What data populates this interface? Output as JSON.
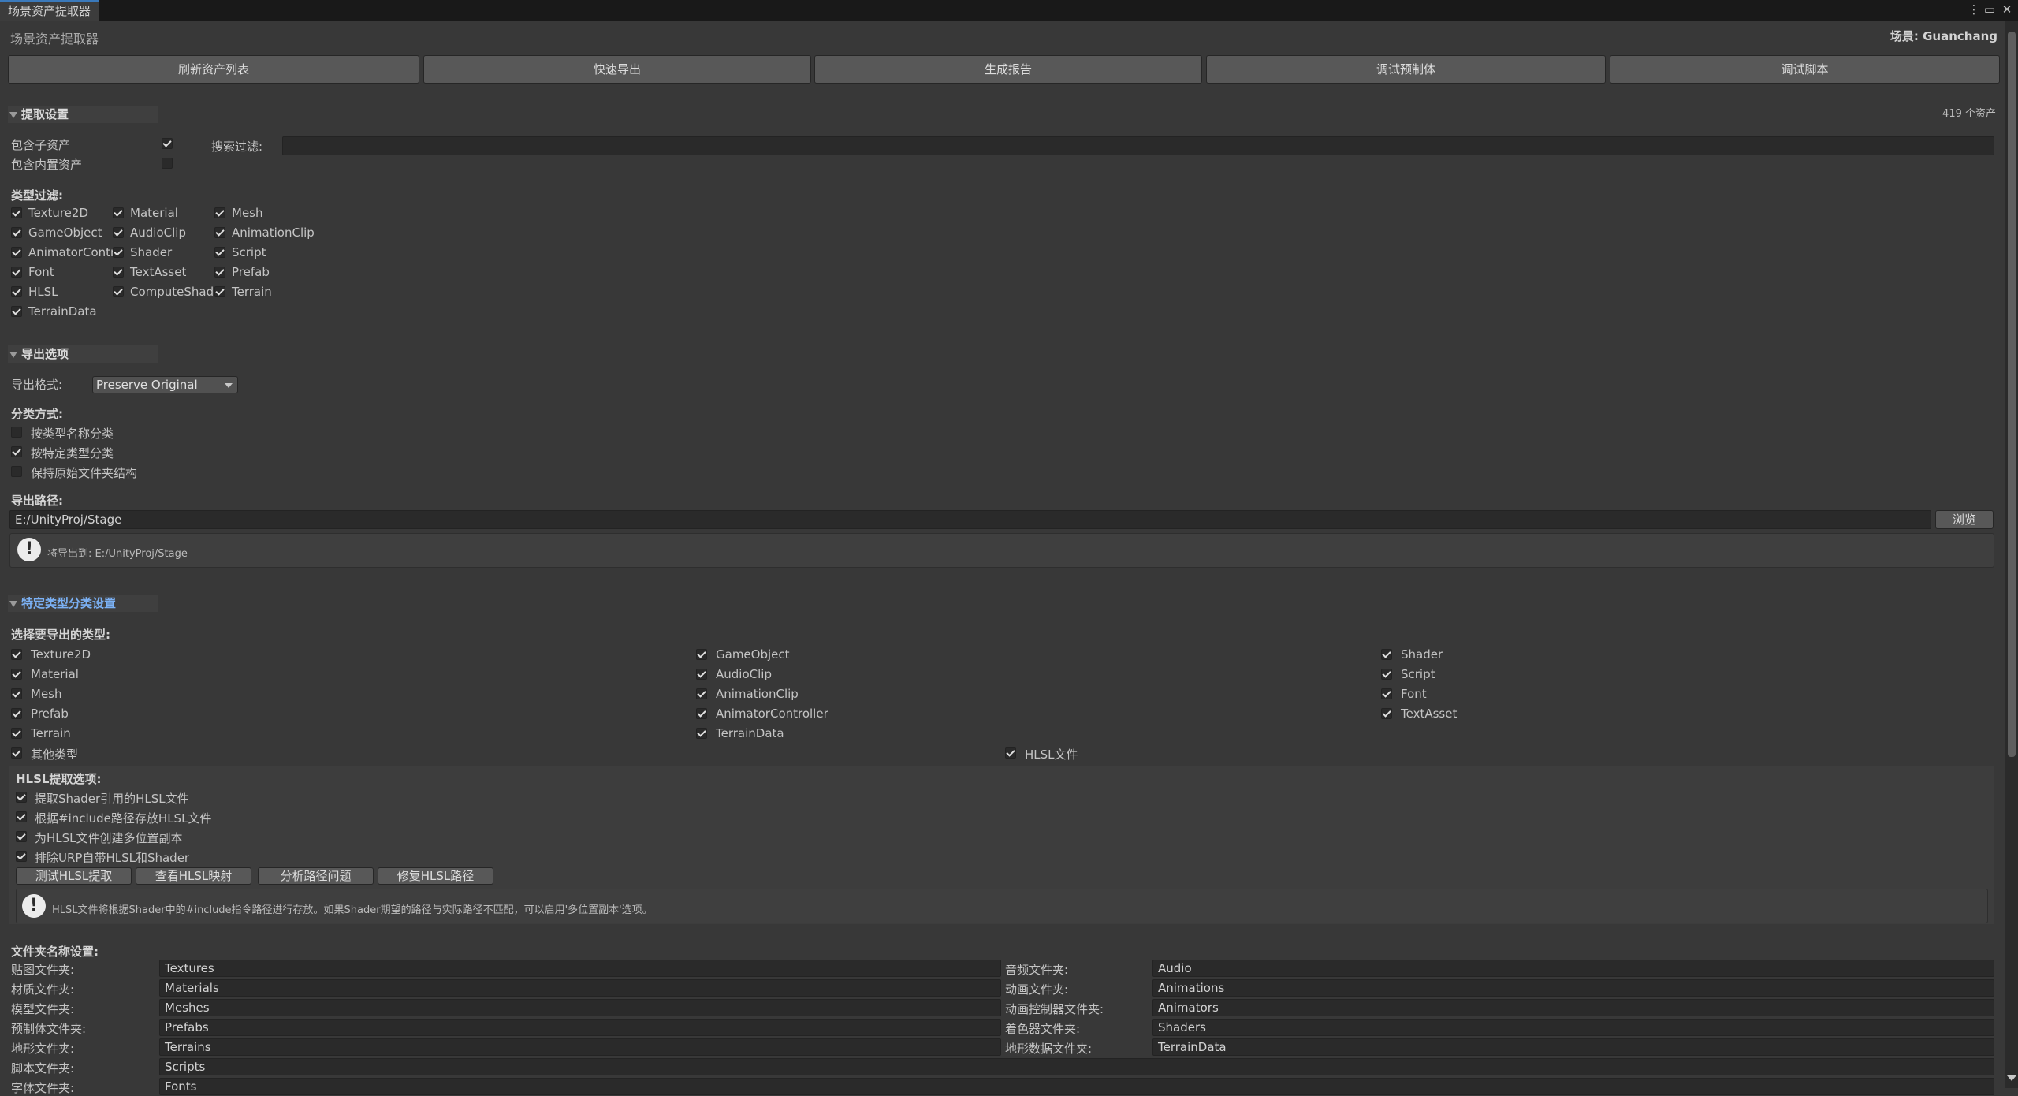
{
  "window": {
    "tab_title": "场景资产提取器",
    "header_title": "场景资产提取器",
    "scene_label": "场景: Guanchang",
    "menu_glyph": "⋮",
    "maximize_glyph": "▭",
    "close_glyph": "✕"
  },
  "toolbar": [
    "刷新资产列表",
    "快速导出",
    "生成报告",
    "调试预制体",
    "调试脚本"
  ],
  "asset_count": "419 个资产",
  "extract_settings": {
    "title": "提取设置",
    "include_sub_assets": {
      "label": "包含子资产",
      "checked": true
    },
    "include_builtin_assets": {
      "label": "包含内置资产",
      "checked": false
    },
    "search_label": "搜索过滤:",
    "search_value": "",
    "type_filter_title": "类型过滤:",
    "type_filters": [
      {
        "label": "Texture2D",
        "checked": true
      },
      {
        "label": "Material",
        "checked": true
      },
      {
        "label": "Mesh",
        "checked": true
      },
      {
        "label": "GameObject",
        "checked": true
      },
      {
        "label": "AudioClip",
        "checked": true
      },
      {
        "label": "AnimationClip",
        "checked": true
      },
      {
        "label": "AnimatorContr",
        "checked": true
      },
      {
        "label": "Shader",
        "checked": true
      },
      {
        "label": "Script",
        "checked": true
      },
      {
        "label": "Font",
        "checked": true
      },
      {
        "label": "TextAsset",
        "checked": true
      },
      {
        "label": "Prefab",
        "checked": true
      },
      {
        "label": "HLSL",
        "checked": true
      },
      {
        "label": "ComputeShad",
        "checked": true
      },
      {
        "label": "Terrain",
        "checked": true
      },
      {
        "label": "TerrainData",
        "checked": true
      }
    ]
  },
  "export_options": {
    "title": "导出选项",
    "format_label": "导出格式:",
    "format_value": "Preserve Original",
    "classify_title": "分类方式:",
    "classify_options": [
      {
        "label": "按类型名称分类",
        "checked": false
      },
      {
        "label": "按特定类型分类",
        "checked": true
      },
      {
        "label": "保持原始文件夹结构",
        "checked": false
      }
    ],
    "path_title": "导出路径:",
    "path_value": "E:/UnityProj/Stage",
    "browse_label": "浏览",
    "help_text": "将导出到: E:/UnityProj/Stage"
  },
  "specific_types": {
    "title": "特定类型分类设置",
    "select_title": "选择要导出的类型:",
    "col1": [
      {
        "label": "Texture2D",
        "checked": true
      },
      {
        "label": "Material",
        "checked": true
      },
      {
        "label": "Mesh",
        "checked": true
      },
      {
        "label": "Prefab",
        "checked": true
      },
      {
        "label": "Terrain",
        "checked": true
      },
      {
        "label": "其他类型",
        "checked": true
      }
    ],
    "col2": [
      {
        "label": "GameObject",
        "checked": true
      },
      {
        "label": "AudioClip",
        "checked": true
      },
      {
        "label": "AnimationClip",
        "checked": true
      },
      {
        "label": "AnimatorController",
        "checked": true
      },
      {
        "label": "TerrainData",
        "checked": true
      }
    ],
    "col3": [
      {
        "label": "Shader",
        "checked": true
      },
      {
        "label": "Script",
        "checked": true
      },
      {
        "label": "Font",
        "checked": true
      },
      {
        "label": "TextAsset",
        "checked": true
      }
    ],
    "hlsl_file": {
      "label": "HLSL文件",
      "checked": true
    },
    "hlsl_options_title": "HLSL提取选项:",
    "hlsl_options": [
      {
        "label": "提取Shader引用的HLSL文件",
        "checked": true
      },
      {
        "label": "根据#include路径存放HLSL文件",
        "checked": true
      },
      {
        "label": "为HLSL文件创建多位置副本",
        "checked": true
      },
      {
        "label": "排除URP自带HLSL和Shader",
        "checked": true
      }
    ],
    "hlsl_buttons": [
      "测试HLSL提取",
      "查看HLSL映射",
      "分析路径问题",
      "修复HLSL路径"
    ],
    "hlsl_help": "HLSL文件将根据Shader中的#include指令路径进行存放。如果Shader期望的路径与实际路径不匹配，可以启用'多位置副本'选项。"
  },
  "folder_names": {
    "title": "文件夹名称设置:",
    "left": [
      {
        "label": "贴图文件夹:",
        "value": "Textures"
      },
      {
        "label": "材质文件夹:",
        "value": "Materials"
      },
      {
        "label": "模型文件夹:",
        "value": "Meshes"
      },
      {
        "label": "预制体文件夹:",
        "value": "Prefabs"
      },
      {
        "label": "地形文件夹:",
        "value": "Terrains"
      },
      {
        "label": "脚本文件夹:",
        "value": "Scripts"
      },
      {
        "label": "字体文件夹:",
        "value": "Fonts"
      }
    ],
    "right": [
      {
        "label": "音频文件夹:",
        "value": "Audio"
      },
      {
        "label": "动画文件夹:",
        "value": "Animations"
      },
      {
        "label": "动画控制器文件夹:",
        "value": "Animators"
      },
      {
        "label": "着色器文件夹:",
        "value": "Shaders"
      },
      {
        "label": "地形数据文件夹:",
        "value": "TerrainData"
      }
    ]
  },
  "colors": {
    "background": "#383838",
    "accent_blue": "#7bb1f5",
    "tab_accent": "#3a79bb",
    "button": "#585858",
    "field": "#2a2a2a"
  }
}
